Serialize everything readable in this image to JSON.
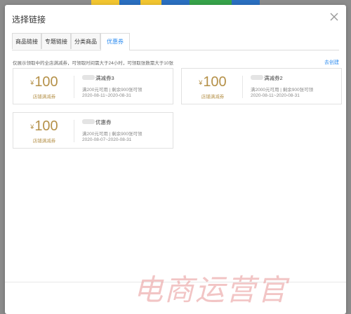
{
  "dialog": {
    "title": "选择链接",
    "tabs": [
      {
        "label": "商品链接"
      },
      {
        "label": "专题链接"
      },
      {
        "label": "分类商品"
      },
      {
        "label": "优惠券"
      }
    ],
    "notice": "仅展示领取中的全店满减券，可领取时间需大于24小时，可领取张数需大于10张",
    "create_link": "去创建"
  },
  "coupons": [
    {
      "symbol": "¥",
      "amount": "100",
      "type": "店铺满减券",
      "name": "满减券3",
      "condition": "满200元可用 | 剩余900张可领",
      "period": "2020-08-11~2020-08-31"
    },
    {
      "symbol": "¥",
      "amount": "100",
      "type": "店铺满减券",
      "name": "满减券2",
      "condition": "满2000元可用 | 剩余900张可领",
      "period": "2020-08-11~2020-08-31"
    },
    {
      "symbol": "¥",
      "amount": "100",
      "type": "店铺满减券",
      "name": "优惠券",
      "condition": "满200元可用 | 剩余900张可领",
      "period": "2020-08-07~2020-08-31"
    }
  ],
  "watermark": "电商运营官",
  "colors": {
    "accent": "#2d8cf0",
    "coupon_gold": "#b59149"
  }
}
